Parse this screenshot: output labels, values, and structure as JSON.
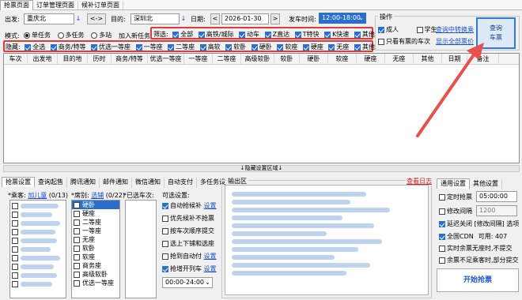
{
  "tabs": [
    "抢票页面",
    "订单管理页面",
    "候补订单页面"
  ],
  "query": {
    "from_label": "出发:",
    "from_value": "重庆北",
    "swap_label": "<->",
    "to_label": "目的:",
    "to_value": "深圳北",
    "date_label": "日期:",
    "date_value": "2026-01-30",
    "time_label": "发车时间:",
    "time_value": "12:00-18:00",
    "prev_day": "<",
    "next_day": ">"
  },
  "mode": {
    "label": "模式:",
    "options": [
      "单任务",
      "多任务",
      "多站"
    ],
    "selected": "单任务",
    "add_task": "加入新任务"
  },
  "filter": {
    "label": "筛选:",
    "items": [
      "全部",
      "高铁/城际",
      "动车",
      "Z直达",
      "T特快",
      "K快速",
      "其他"
    ]
  },
  "hide": {
    "label": "隐藏:",
    "items": [
      "全选",
      "商务/特等",
      "优选一等座",
      "一等座",
      "二等座",
      "高软",
      "软卧",
      "硬卧",
      "软座",
      "硬座",
      "无座",
      "其他"
    ]
  },
  "ops": {
    "title": "操作",
    "adult": "成人",
    "student": "学生",
    "only_ticket": "只看有票的车次",
    "link_transfer": "查询中转换乘",
    "link_all_prices": "显示全部票价",
    "query_btn_line1": "查询",
    "query_btn_line2": "车票"
  },
  "table": {
    "headers": [
      "车次",
      "出发地",
      "目的地",
      "历时",
      "商务/特等",
      "优选一等座",
      "一等座",
      "二等座",
      "高级软卧",
      "软卧",
      "硬卧",
      "软座",
      "硬座",
      "无座",
      "其他",
      "日期",
      "备注"
    ]
  },
  "splitter_label": "↓隐藏设置区域↓",
  "bottom_tabs": [
    "抢票设置",
    "查询起售",
    "腾讯通知",
    "邮件通知",
    "微信通知",
    "自动支付",
    "多任务设置"
  ],
  "passengers": {
    "label": "*乘客:",
    "add_link": "加儿童",
    "count": "(0/13)"
  },
  "seats": {
    "label": "*席别:",
    "link": "选辅",
    "count": "(0/22)",
    "items": [
      "硬卧",
      "硬座",
      "二等座",
      "一等座",
      "无座",
      "软卧",
      "软座",
      "商务座",
      "高级软卧",
      "优选一等座"
    ]
  },
  "selected_trains_label": "*已选车次:",
  "options": {
    "title": "可选设置:",
    "items": [
      {
        "label": "自动抢候补",
        "checked": true,
        "link": "设置"
      },
      {
        "label": "优先候补不抢票",
        "checked": false
      },
      {
        "label": "按车次顺序提交",
        "checked": false
      },
      {
        "label": "选上下铺和选座",
        "checked": false
      },
      {
        "label": "抢到自动付",
        "checked": false,
        "link": "设置"
      },
      {
        "label": "抢增开列车",
        "checked": true,
        "link": "设置"
      }
    ],
    "time_range": "00:00-24:00"
  },
  "output": {
    "title": "输出区",
    "log_link": "查看日志"
  },
  "general": {
    "tabs": [
      "通用设置",
      "其他设置"
    ],
    "timed_label": "定时抢票",
    "timed_value": "05:00:00",
    "interval_label": "修改间隔",
    "interval_value": "1200",
    "delay_label": "延迟关闭 [修改间隔] 选项",
    "cdn_label": "全国CDN",
    "cdn_avail": "可用: 407",
    "realtime_label": "实时余票无座时,不提交",
    "insufficient_label": "余票不足乘客时,部分提交",
    "start_btn": "开始抢票"
  }
}
